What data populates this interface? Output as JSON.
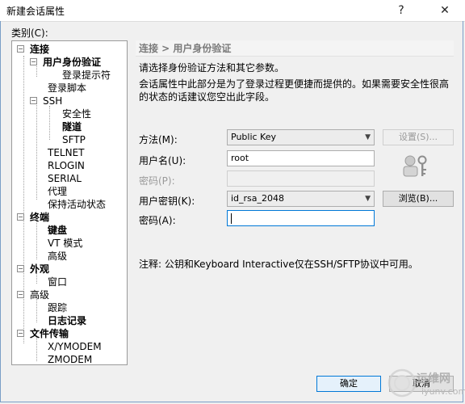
{
  "window": {
    "title": "新建会话属性",
    "help": "?",
    "close": "✕"
  },
  "category_label": "类别(C):",
  "category_label_hotkey": "C",
  "tree": [
    {
      "id": "conn",
      "label": "连接",
      "bold": true
    },
    {
      "id": "auth",
      "label": "用户身份验证",
      "bold": true
    },
    {
      "id": "login-prompt",
      "label": "登录提示符",
      "bold": false
    },
    {
      "id": "login-script",
      "label": "登录脚本",
      "bold": false
    },
    {
      "id": "ssh",
      "label": "SSH",
      "bold": false
    },
    {
      "id": "security",
      "label": "安全性",
      "bold": false
    },
    {
      "id": "tunnel",
      "label": "隧道",
      "bold": true
    },
    {
      "id": "sftp",
      "label": "SFTP",
      "bold": false
    },
    {
      "id": "telnet",
      "label": "TELNET",
      "bold": false
    },
    {
      "id": "rlogin",
      "label": "RLOGIN",
      "bold": false
    },
    {
      "id": "serial",
      "label": "SERIAL",
      "bold": false
    },
    {
      "id": "proxy",
      "label": "代理",
      "bold": false
    },
    {
      "id": "keepalive",
      "label": "保持活动状态",
      "bold": false
    },
    {
      "id": "terminal",
      "label": "终端",
      "bold": true
    },
    {
      "id": "keyboard",
      "label": "键盘",
      "bold": true
    },
    {
      "id": "vt",
      "label": "VT 模式",
      "bold": false
    },
    {
      "id": "term-adv",
      "label": "高级",
      "bold": false
    },
    {
      "id": "appearance",
      "label": "外观",
      "bold": true
    },
    {
      "id": "window",
      "label": "窗口",
      "bold": false
    },
    {
      "id": "advanced",
      "label": "高级",
      "bold": false
    },
    {
      "id": "trace",
      "label": "跟踪",
      "bold": false
    },
    {
      "id": "logging",
      "label": "日志记录",
      "bold": true
    },
    {
      "id": "filetransfer",
      "label": "文件传输",
      "bold": true
    },
    {
      "id": "xymodem",
      "label": "X/YMODEM",
      "bold": false
    },
    {
      "id": "zmodem",
      "label": "ZMODEM",
      "bold": false
    }
  ],
  "panel": {
    "header": "连接 > 用户身份验证",
    "desc1": "请选择身份验证方法和其它参数。",
    "desc2": "会话属性中此部分是为了登录过程更便捷而提供的。如果需要安全性很高",
    "desc3": "的状态的话建议您空出此字段。",
    "method_label": "方法(M):",
    "method_value": "Public Key",
    "settings_button": "设置(S)...",
    "username_label": "用户名(U):",
    "username_value": "root",
    "password_label": "密码(P):",
    "password_value": "",
    "userkey_label": "用户密钥(K):",
    "userkey_value": "id_rsa_2048",
    "browse_button": "浏览(B)...",
    "passphrase_label": "密码(A):",
    "passphrase_value": "",
    "note": "注释: 公钥和Keyboard Interactive仅在SSH/SFTP协议中可用。"
  },
  "buttons": {
    "ok": "确定",
    "cancel": "取消"
  },
  "watermark": {
    "text": "运维网",
    "sub": "iyunv.com"
  }
}
